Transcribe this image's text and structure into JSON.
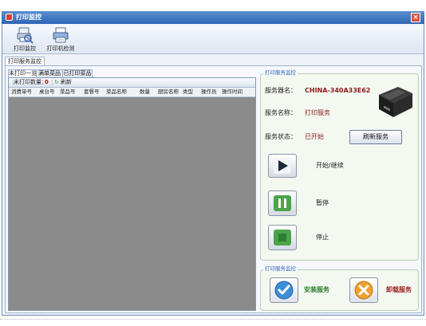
{
  "window": {
    "title": "打印监控"
  },
  "toolbar": {
    "buttons": [
      {
        "label": "打印监控",
        "icon": "monitor-icon"
      },
      {
        "label": "打印机检测",
        "icon": "printer-icon"
      }
    ]
  },
  "outer_tab": {
    "label": "打印服务监控"
  },
  "inner_tabs": [
    "未打印一览",
    "满单菜品",
    "已打印菜品"
  ],
  "list_toolbar": {
    "count_label": "未打印数量：",
    "count_value": "0",
    "refresh_label": "刷新"
  },
  "table": {
    "columns": [
      "消费单号",
      "桌台号",
      "菜品号",
      "套餐号",
      "菜品名称",
      "数量",
      "厨房名称",
      "类型",
      "操作员",
      "操作时间"
    ],
    "rows": []
  },
  "service_group": {
    "title": "打印服务监控",
    "server_label": "服务器名：",
    "server_value": "CHINA-340A33E62",
    "name_label": "服务名称：",
    "name_value": "打印服务",
    "status_label": "服务状态：",
    "status_value": "已开始",
    "refresh_button": "刷新服务",
    "start_label": "开始/继续",
    "pause_label": "暂停",
    "stop_label": "停止"
  },
  "install_group": {
    "title": "打印服务监控",
    "install_label": "安装服务",
    "uninstall_label": "卸载服务"
  },
  "colors": {
    "accent": "#3567b6",
    "value_red": "#8b1a1a",
    "service_green": "#2e7d32",
    "uninstall_red": "#9b1f1f"
  }
}
